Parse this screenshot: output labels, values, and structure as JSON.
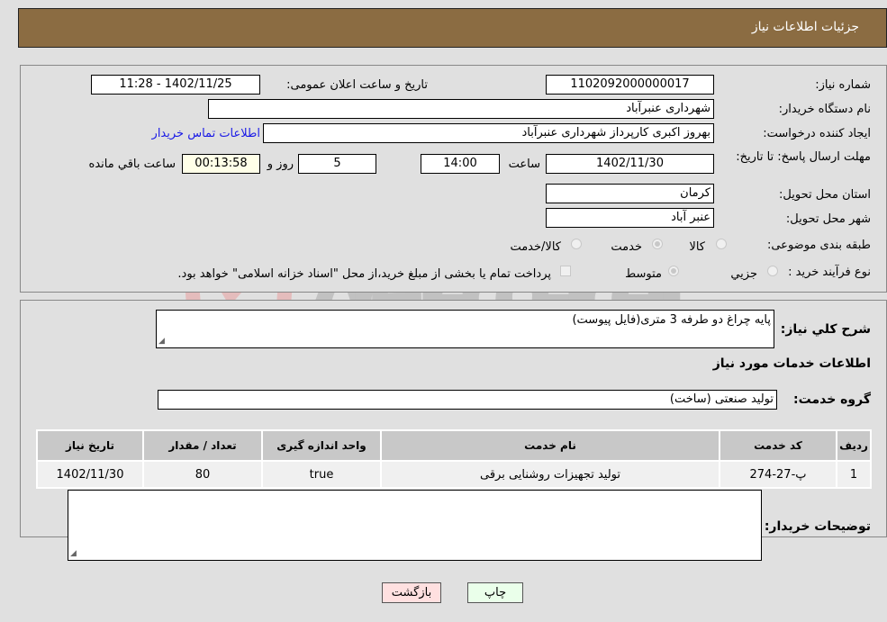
{
  "header": {
    "title": "جزئیات اطلاعات نیاز"
  },
  "form": {
    "need_number_label": "شماره نیاز:",
    "need_number": "1102092000000017",
    "announce_label": "تاریخ و ساعت اعلان عمومی:",
    "announce_value": "1402/11/25 - 11:28",
    "buyer_org_label": "نام دستگاه خریدار:",
    "buyer_org": "شهرداری عنبرآباد",
    "creator_label": "ایجاد کننده درخواست:",
    "creator": "بهروز اکبری کارپرداز شهرداری عنبرآباد",
    "contact_link": "اطلاعات تماس خریدار",
    "deadline_label": "مهلت ارسال پاسخ: تا تاریخ:",
    "deadline_date": "1402/11/30",
    "time_label": "ساعت",
    "deadline_time": "14:00",
    "days_value": "5",
    "days_label": "روز و",
    "remaining_time": "00:13:58",
    "remaining_label": "ساعت باقي مانده",
    "province_label": "استان محل تحویل:",
    "province": "کرمان",
    "city_label": "شهر محل تحویل:",
    "city": "عنبر آباد",
    "category_label": "طبقه بندی موضوعی:",
    "category_options": [
      {
        "label": "کالا",
        "selected": false
      },
      {
        "label": "خدمت",
        "selected": true
      },
      {
        "label": "کالا/خدمت",
        "selected": false
      }
    ],
    "process_label": "نوع فرآیند خرید :",
    "process_options": [
      {
        "label": "جزیي",
        "selected": false
      },
      {
        "label": "متوسط",
        "selected": true
      }
    ],
    "treasury_note": "پرداخت تمام یا بخشی از مبلغ خرید،از محل \"اسناد خزانه اسلامی\" خواهد بود.",
    "treasury_checked": false
  },
  "details": {
    "description_label": "شرح كلي نياز:",
    "description": "پایه چراغ دو طرفه 3 متری(فایل پیوست)",
    "services_heading": "اطلاعات خدمات مورد نیاز",
    "service_group_label": "گروه خدمت:",
    "service_group": "تولید صنعتی (ساخت)",
    "table": {
      "headers": [
        "ردیف",
        "کد خدمت",
        "نام خدمت",
        "واحد اندازه گیری",
        "تعداد / مقدار",
        "تاریخ نیاز"
      ],
      "rows": [
        [
          "1",
          "پ-27-274",
          "تولید تجهیزات روشنایی برقی",
          "true",
          "80",
          "1402/11/30"
        ]
      ]
    },
    "buyer_notes_label": "توضیحات خریدار:",
    "buyer_notes": ""
  },
  "buttons": {
    "print": "چاپ",
    "back": "بازگشت"
  },
  "watermark": {
    "text": "AriaTender.neT"
  },
  "colors": {
    "header_bg": "#8b6c42",
    "print_bg": "#eaffea",
    "back_bg": "#ffe0e0",
    "link": "#1a1ae6"
  }
}
